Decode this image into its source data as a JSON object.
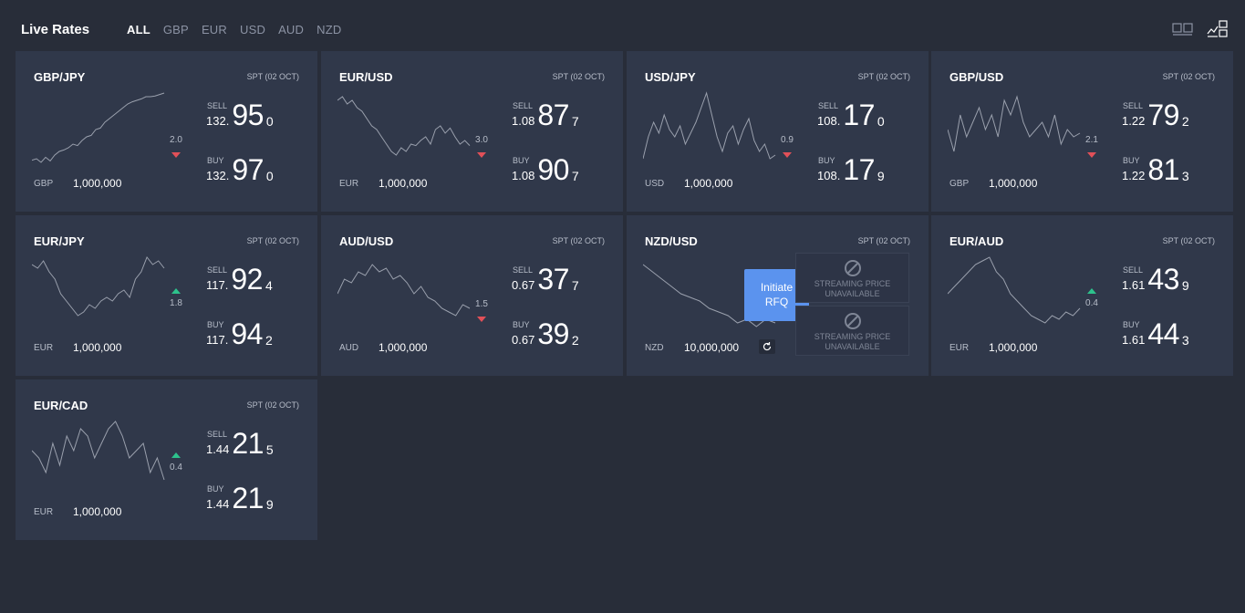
{
  "header": {
    "title": "Live Rates",
    "filters": [
      "ALL",
      "GBP",
      "EUR",
      "USD",
      "AUD",
      "NZD"
    ]
  },
  "colors": {
    "down": "#e25058",
    "up": "#2dc28c",
    "rfq": "#5b93ee"
  },
  "tiles": [
    {
      "pair": "GBP/JPY",
      "spt": "SPT (02 OCT)",
      "ccy": "GBP",
      "notional": "1,000,000",
      "spread": "2.0",
      "direction": "down",
      "sell": {
        "label": "SELL",
        "big1": "132.",
        "big2": "95",
        "pip": "0"
      },
      "buy": {
        "label": "BUY",
        "big1": "132.",
        "big2": "97",
        "pip": "0"
      }
    },
    {
      "pair": "EUR/USD",
      "spt": "SPT (02 OCT)",
      "ccy": "EUR",
      "notional": "1,000,000",
      "spread": "3.0",
      "direction": "down",
      "sell": {
        "label": "SELL",
        "big1": "1.08",
        "big2": "87",
        "pip": "7"
      },
      "buy": {
        "label": "BUY",
        "big1": "1.08",
        "big2": "90",
        "pip": "7"
      }
    },
    {
      "pair": "USD/JPY",
      "spt": "SPT (02 OCT)",
      "ccy": "USD",
      "notional": "1,000,000",
      "spread": "0.9",
      "direction": "down",
      "sell": {
        "label": "SELL",
        "big1": "108.",
        "big2": "17",
        "pip": "0"
      },
      "buy": {
        "label": "BUY",
        "big1": "108.",
        "big2": "17",
        "pip": "9"
      }
    },
    {
      "pair": "GBP/USD",
      "spt": "SPT (02 OCT)",
      "ccy": "GBP",
      "notional": "1,000,000",
      "spread": "2.1",
      "direction": "down",
      "sell": {
        "label": "SELL",
        "big1": "1.22",
        "big2": "79",
        "pip": "2"
      },
      "buy": {
        "label": "BUY",
        "big1": "1.22",
        "big2": "81",
        "pip": "3"
      }
    },
    {
      "pair": "EUR/JPY",
      "spt": "SPT (02 OCT)",
      "ccy": "EUR",
      "notional": "1,000,000",
      "spread": "1.8",
      "direction": "up",
      "sell": {
        "label": "SELL",
        "big1": "117.",
        "big2": "92",
        "pip": "4"
      },
      "buy": {
        "label": "BUY",
        "big1": "117.",
        "big2": "94",
        "pip": "2"
      }
    },
    {
      "pair": "AUD/USD",
      "spt": "SPT (02 OCT)",
      "ccy": "AUD",
      "notional": "1,000,000",
      "spread": "1.5",
      "direction": "down",
      "sell": {
        "label": "SELL",
        "big1": "0.67",
        "big2": "37",
        "pip": "7"
      },
      "buy": {
        "label": "BUY",
        "big1": "0.67",
        "big2": "39",
        "pip": "2"
      }
    },
    {
      "pair": "NZD/USD",
      "spt": "SPT (02 OCT)",
      "ccy": "NZD",
      "notional": "10,000,000",
      "rfq": true,
      "rfq_label_1": "Initiate",
      "rfq_label_2": "RFQ",
      "unavailable_1": "STREAMING PRICE",
      "unavailable_2": "UNAVAILABLE"
    },
    {
      "pair": "EUR/AUD",
      "spt": "SPT (02 OCT)",
      "ccy": "EUR",
      "notional": "1,000,000",
      "spread": "0.4",
      "direction": "up",
      "sell": {
        "label": "SELL",
        "big1": "1.61",
        "big2": "43",
        "pip": "9"
      },
      "buy": {
        "label": "BUY",
        "big1": "1.61",
        "big2": "44",
        "pip": "3"
      }
    },
    {
      "pair": "EUR/CAD",
      "spt": "SPT (02 OCT)",
      "ccy": "EUR",
      "notional": "1,000,000",
      "spread": "0.4",
      "direction": "up",
      "sell": {
        "label": "SELL",
        "big1": "1.44",
        "big2": "21",
        "pip": "5"
      },
      "buy": {
        "label": "BUY",
        "big1": "1.44",
        "big2": "21",
        "pip": "9"
      }
    }
  ]
}
